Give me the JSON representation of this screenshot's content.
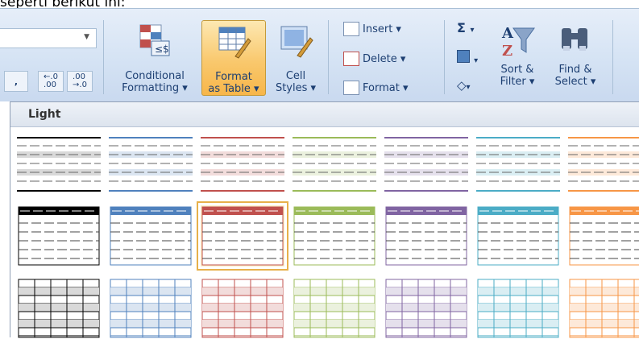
{
  "caption": "seperti berikut ini:",
  "ribbon": {
    "number_buttons": [
      "•",
      "⁺.0\n.00",
      ".00\n→.0"
    ],
    "conditional_formatting": "Conditional\nFormatting ▾",
    "format_as_table": "Format\nas Table ▾",
    "cell_styles": "Cell\nStyles ▾",
    "insert": "Insert ▾",
    "delete": "Delete ▾",
    "format": "Format ▾",
    "sort_filter": "Sort &\nFilter ▾",
    "find_select": "Find &\nSelect ▾"
  },
  "gallery": {
    "header": "Light",
    "colors": [
      "#000000",
      "#4f81bd",
      "#c0504d",
      "#9bbb59",
      "#8064a2",
      "#4bacc6",
      "#f79646"
    ],
    "fills": [
      "#d9d9d9",
      "#dbe5f1",
      "#f2dcdb",
      "#ebf1de",
      "#e5e0ec",
      "#daeef3",
      "#fde9d9"
    ],
    "selected_row": 1,
    "selected_col": 2
  }
}
